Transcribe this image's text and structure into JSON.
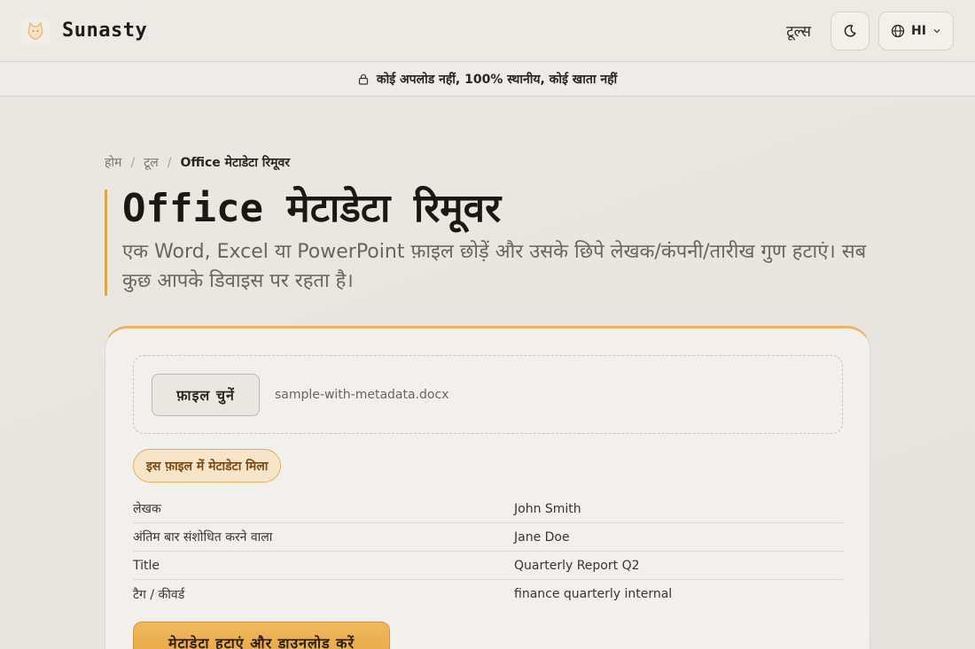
{
  "header": {
    "brand": "Sunasty",
    "tools_link": "टूल्स",
    "language": "HI"
  },
  "notice": {
    "text": "कोई अपलोड नहीं, 100% स्थानीय, कोई खाता नहीं"
  },
  "breadcrumb": {
    "home": "होम",
    "sep1": "/",
    "tools": "टूल",
    "sep2": "/",
    "current": "Office मेटाडेटा रिमूवर"
  },
  "hero": {
    "title": "Office मेटाडेटा रिमूवर",
    "subtitle": "एक Word, Excel या PowerPoint फ़ाइल छोड़ें और उसके छिपे लेखक/कंपनी/तारीख गुण हटाएं। सब कुछ आपके डिवाइस पर रहता है।"
  },
  "uploader": {
    "choose_label": "फ़ाइल चुनें",
    "file_name": "sample-with-metadata.docx"
  },
  "result": {
    "badge": "इस फ़ाइल में मेटाडेटा मिला",
    "rows": [
      {
        "key": "लेखक",
        "value": "John Smith"
      },
      {
        "key": "अंतिम बार संशोधित करने वाला",
        "value": "Jane Doe"
      },
      {
        "key": "Title",
        "value": "Quarterly Report Q2"
      },
      {
        "key": "टैग / कीवर्ड",
        "value": "finance quarterly internal"
      }
    ],
    "action_label": "मेटाडेटा हटाएं और डाउनलोड करें"
  },
  "icons": {
    "logo": "cat-logo-icon",
    "theme": "moon-icon",
    "language": "globe-icon",
    "dropdown": "chevron-down-icon",
    "notice": "lock-icon"
  },
  "colors": {
    "accent": "#e9a53f",
    "badge_bg": "#f6e5c8",
    "badge_text": "#7a4a16"
  }
}
